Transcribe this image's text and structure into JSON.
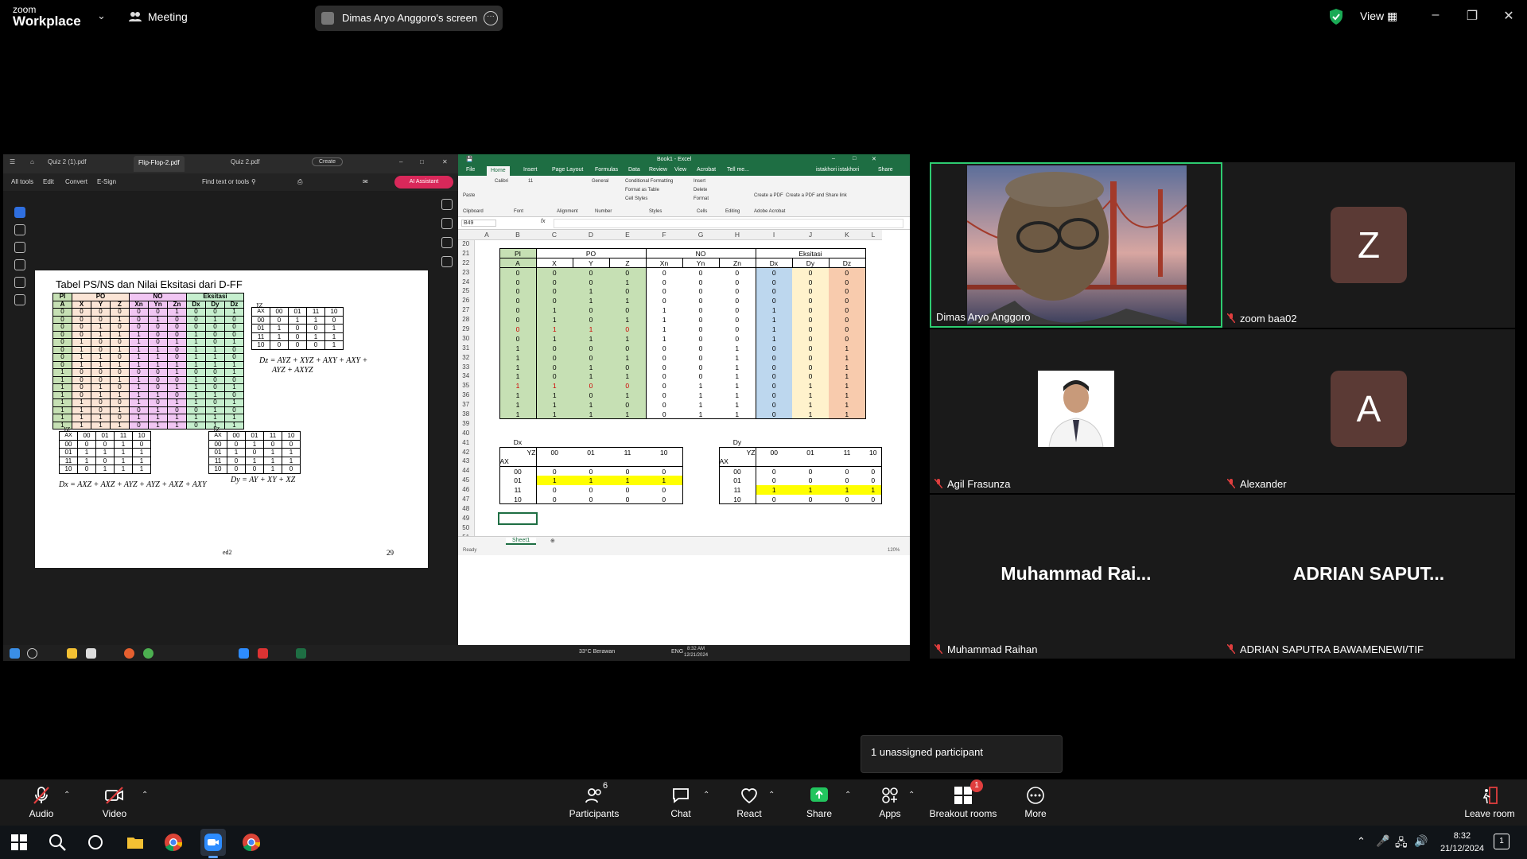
{
  "zoom": {
    "logo_top": "zoom",
    "logo_bottom": "Workplace",
    "meeting_label": "Meeting",
    "screen_label": "Dimas Aryo Anggoro's screen",
    "view_label": "View"
  },
  "pdf": {
    "tabs": [
      "Quiz 2 (1).pdf",
      "Flip-Flop-2.pdf",
      "Quiz 2.pdf"
    ],
    "create_label": "Create",
    "menu": [
      "All tools",
      "Edit",
      "Convert",
      "E-Sign"
    ],
    "find_label": "Find text or tools",
    "ai_label": "AI Assistant",
    "page_title": "Tabel PS/NS dan Nilai Eksitasi dari D-FF",
    "group_headers": [
      "PI",
      "PO",
      "NO",
      "Eksitasi"
    ],
    "col_headers": [
      "A",
      "X",
      "Y",
      "Z",
      "Xn",
      "Yn",
      "Zn",
      "Dx",
      "Dy",
      "Dz"
    ],
    "rows": [
      [
        "0",
        "0",
        "0",
        "0",
        "0",
        "0",
        "1",
        "0",
        "0",
        "1"
      ],
      [
        "0",
        "0",
        "0",
        "1",
        "0",
        "1",
        "0",
        "0",
        "1",
        "0"
      ],
      [
        "0",
        "0",
        "1",
        "0",
        "0",
        "0",
        "0",
        "0",
        "0",
        "0"
      ],
      [
        "0",
        "0",
        "1",
        "1",
        "1",
        "0",
        "0",
        "1",
        "0",
        "0"
      ],
      [
        "0",
        "1",
        "0",
        "0",
        "1",
        "0",
        "1",
        "1",
        "0",
        "1"
      ],
      [
        "0",
        "1",
        "0",
        "1",
        "1",
        "1",
        "0",
        "1",
        "1",
        "0"
      ],
      [
        "0",
        "1",
        "1",
        "0",
        "1",
        "1",
        "0",
        "1",
        "1",
        "0"
      ],
      [
        "0",
        "1",
        "1",
        "1",
        "1",
        "1",
        "1",
        "1",
        "1",
        "1"
      ],
      [
        "1",
        "0",
        "0",
        "0",
        "0",
        "0",
        "1",
        "0",
        "0",
        "1"
      ],
      [
        "1",
        "0",
        "0",
        "1",
        "1",
        "0",
        "0",
        "1",
        "0",
        "0"
      ],
      [
        "1",
        "0",
        "1",
        "0",
        "1",
        "0",
        "1",
        "1",
        "0",
        "1"
      ],
      [
        "1",
        "0",
        "1",
        "1",
        "1",
        "1",
        "0",
        "1",
        "1",
        "0"
      ],
      [
        "1",
        "1",
        "0",
        "0",
        "1",
        "0",
        "1",
        "1",
        "0",
        "1"
      ],
      [
        "1",
        "1",
        "0",
        "1",
        "0",
        "1",
        "0",
        "0",
        "1",
        "0"
      ],
      [
        "1",
        "1",
        "1",
        "0",
        "1",
        "1",
        "1",
        "1",
        "1",
        "1"
      ],
      [
        "1",
        "1",
        "1",
        "1",
        "0",
        "1",
        "1",
        "0",
        "1",
        "1"
      ]
    ],
    "kmap_corner": "AX",
    "kmap_yz": "YZ",
    "kmap_cols": [
      "00",
      "01",
      "11",
      "10"
    ],
    "kmap_dz": [
      [
        "0",
        "1",
        "1",
        "0"
      ],
      [
        "1",
        "0",
        "0",
        "1"
      ],
      [
        "1",
        "0",
        "1",
        "1"
      ],
      [
        "0",
        "0",
        "0",
        "1"
      ]
    ],
    "eq_dz_1": "Dz = AYZ + XYZ + AXY + AXY +",
    "eq_dz_2": "AYZ + AXYZ",
    "kmap_dx": [
      [
        "0",
        "0",
        "1",
        "0"
      ],
      [
        "1",
        "1",
        "1",
        "1"
      ],
      [
        "1",
        "0",
        "1",
        "1"
      ],
      [
        "0",
        "1",
        "1",
        "1"
      ]
    ],
    "eq_dx": "Dx = AXZ + AXZ + AYZ + AYZ + AXZ + AXY",
    "kmap_dy": [
      [
        "0",
        "1",
        "0",
        "0"
      ],
      [
        "1",
        "0",
        "1",
        "1"
      ],
      [
        "0",
        "1",
        "1",
        "1"
      ],
      [
        "0",
        "0",
        "1",
        "0"
      ]
    ],
    "eq_dy": "Dy = AY + XY + XZ",
    "ed_label": "ed2",
    "page_number": "29"
  },
  "excel": {
    "title": "Book1 - Excel",
    "tabs": [
      "File",
      "Home",
      "Insert",
      "Page Layout",
      "Formulas",
      "Data",
      "Review",
      "View",
      "Acrobat",
      "Tell me..."
    ],
    "user": "istakhori istakhori",
    "share": "Share",
    "ribbon_groups": [
      "Clipboard",
      "Font",
      "Alignment",
      "Number",
      "Styles",
      "Cells",
      "Editing",
      "Adobe Acrobat"
    ],
    "ribbon_items": [
      "Paste",
      "Calibri",
      "11",
      "General",
      "Conditional Formatting",
      "Format as Table",
      "Cell Styles",
      "Insert",
      "Delete",
      "Format",
      "Create a PDF",
      "Create a PDF and Share link"
    ],
    "name_box": "B49",
    "columns": [
      "A",
      "B",
      "C",
      "D",
      "E",
      "F",
      "G",
      "H",
      "I",
      "J",
      "K",
      "L"
    ],
    "row_numbers": [
      "20",
      "21",
      "22",
      "23",
      "24",
      "25",
      "26",
      "27",
      "28",
      "29",
      "30",
      "31",
      "32",
      "33",
      "34",
      "35",
      "36",
      "37",
      "38",
      "39",
      "40",
      "41",
      "42",
      "43",
      "44",
      "45",
      "46",
      "47",
      "48",
      "49",
      "50",
      "51"
    ],
    "main_groups": [
      "PI",
      "PO",
      "NO",
      "Eksitasi"
    ],
    "main_headers": [
      "A",
      "X",
      "Y",
      "Z",
      "Xn",
      "Yn",
      "Zn",
      "Dx",
      "Dy",
      "Dz"
    ],
    "main_rows": [
      [
        "0",
        "0",
        "0",
        "0",
        "0",
        "0",
        "0",
        "0",
        "0",
        "0"
      ],
      [
        "0",
        "0",
        "0",
        "1",
        "0",
        "0",
        "0",
        "0",
        "0",
        "0"
      ],
      [
        "0",
        "0",
        "1",
        "0",
        "0",
        "0",
        "0",
        "0",
        "0",
        "0"
      ],
      [
        "0",
        "0",
        "1",
        "1",
        "0",
        "0",
        "0",
        "0",
        "0",
        "0"
      ],
      [
        "0",
        "1",
        "0",
        "0",
        "1",
        "0",
        "0",
        "1",
        "0",
        "0"
      ],
      [
        "0",
        "1",
        "0",
        "1",
        "1",
        "0",
        "0",
        "1",
        "0",
        "0"
      ],
      [
        "0",
        "1",
        "1",
        "0",
        "1",
        "0",
        "0",
        "1",
        "0",
        "0"
      ],
      [
        "0",
        "1",
        "1",
        "1",
        "1",
        "0",
        "0",
        "1",
        "0",
        "0"
      ],
      [
        "1",
        "0",
        "0",
        "0",
        "0",
        "0",
        "1",
        "0",
        "0",
        "1"
      ],
      [
        "1",
        "0",
        "0",
        "1",
        "0",
        "0",
        "1",
        "0",
        "0",
        "1"
      ],
      [
        "1",
        "0",
        "1",
        "0",
        "0",
        "0",
        "1",
        "0",
        "0",
        "1"
      ],
      [
        "1",
        "0",
        "1",
        "1",
        "0",
        "0",
        "1",
        "0",
        "0",
        "1"
      ],
      [
        "1",
        "1",
        "0",
        "0",
        "0",
        "1",
        "1",
        "0",
        "1",
        "1"
      ],
      [
        "1",
        "1",
        "0",
        "1",
        "0",
        "1",
        "1",
        "0",
        "1",
        "1"
      ],
      [
        "1",
        "1",
        "1",
        "0",
        "0",
        "1",
        "1",
        "0",
        "1",
        "1"
      ],
      [
        "1",
        "1",
        "1",
        "1",
        "0",
        "1",
        "1",
        "0",
        "1",
        "1"
      ]
    ],
    "dx_label": "Dx",
    "dy_label": "Dy",
    "kmap_yz": "YZ",
    "kmap_ax": "AX",
    "kmap_cols": [
      "00",
      "01",
      "11",
      "10"
    ],
    "kmap_rows": [
      "00",
      "01",
      "11",
      "10"
    ],
    "dx_values": [
      [
        "0",
        "0",
        "0",
        "0"
      ],
      [
        "1",
        "1",
        "1",
        "1"
      ],
      [
        "0",
        "0",
        "0",
        "0"
      ],
      [
        "0",
        "0",
        "0",
        "0"
      ]
    ],
    "dy_values": [
      [
        "0",
        "0",
        "0",
        "0"
      ],
      [
        "0",
        "0",
        "0",
        "0"
      ],
      [
        "1",
        "1",
        "1",
        "1"
      ],
      [
        "0",
        "0",
        "0",
        "0"
      ]
    ],
    "sheet_tab": "Sheet1",
    "status_ready": "Ready",
    "zoom_pct": "120%"
  },
  "shared_taskbar": {
    "weather": "33°C Berawan",
    "lang": "ENG",
    "time": "8:32 AM",
    "date": "12/21/2024"
  },
  "participants": [
    {
      "name": "Dimas Aryo Anggoro"
    },
    {
      "name": "zoom baa02",
      "initial": "Z"
    },
    {
      "name": "Agil Frasunza"
    },
    {
      "name": "Alexander",
      "initial": "A"
    },
    {
      "name": "Muhammad Raihan",
      "display": "Muhammad  Rai..."
    },
    {
      "name": "ADRIAN SAPUTRA BAWAMENEWI/TIF",
      "display": "ADRIAN  SAPUT..."
    }
  ],
  "unassigned": "1 unassigned participant",
  "toolbar": {
    "audio": "Audio",
    "video": "Video",
    "participants": "Participants",
    "participants_count": "6",
    "chat": "Chat",
    "react": "React",
    "share": "Share",
    "apps": "Apps",
    "breakout": "Breakout rooms",
    "breakout_badge": "1",
    "more": "More",
    "leave": "Leave room"
  },
  "taskbar": {
    "time": "8:32",
    "date": "21/12/2024",
    "notif": "1"
  }
}
